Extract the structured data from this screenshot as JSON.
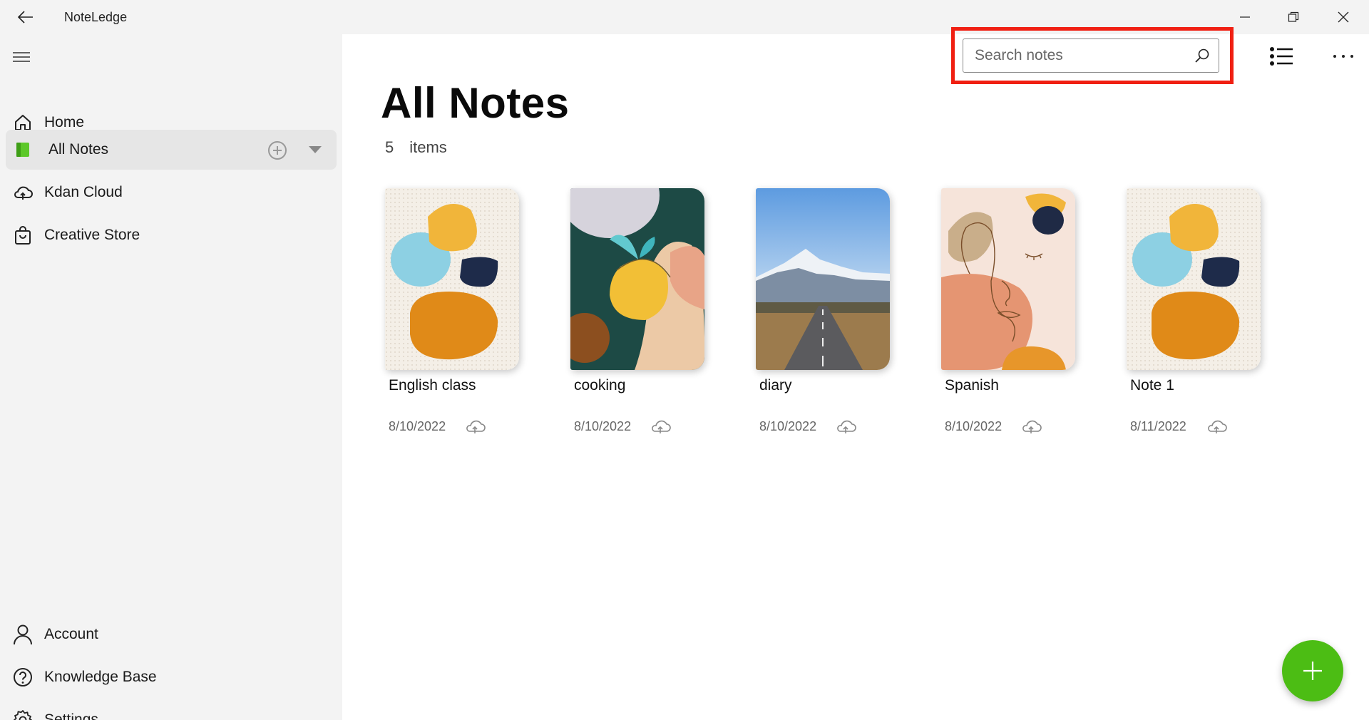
{
  "window": {
    "title": "NoteLedge"
  },
  "sidebar": {
    "items": [
      {
        "label": "Home",
        "icon": "home-icon"
      },
      {
        "label": "All Notes",
        "icon": "notebook-icon",
        "active": true
      },
      {
        "label": "Kdan Cloud",
        "icon": "cloud-icon"
      },
      {
        "label": "Creative Store",
        "icon": "shopping-bag-icon"
      }
    ],
    "bottom_items": [
      {
        "label": "Account",
        "icon": "person-icon"
      },
      {
        "label": "Knowledge Base",
        "icon": "help-icon"
      },
      {
        "label": "Settings",
        "icon": "gear-icon"
      }
    ]
  },
  "main": {
    "title": "All Notes",
    "count": "5",
    "count_label": "items",
    "search": {
      "placeholder": "Search notes"
    },
    "notes": [
      {
        "title": "English class",
        "date": "8/10/2022",
        "cover": "abstract-shapes"
      },
      {
        "title": "cooking",
        "date": "8/10/2022",
        "cover": "lemon"
      },
      {
        "title": "diary",
        "date": "8/10/2022",
        "cover": "mountain-road"
      },
      {
        "title": "Spanish",
        "date": "8/10/2022",
        "cover": "line-face"
      },
      {
        "title": "Note 1",
        "date": "8/11/2022",
        "cover": "abstract-shapes"
      }
    ]
  },
  "colors": {
    "accent_green": "#4cbd14",
    "highlight_red": "#f01f12",
    "sidebar_bg": "#f3f3f3"
  }
}
